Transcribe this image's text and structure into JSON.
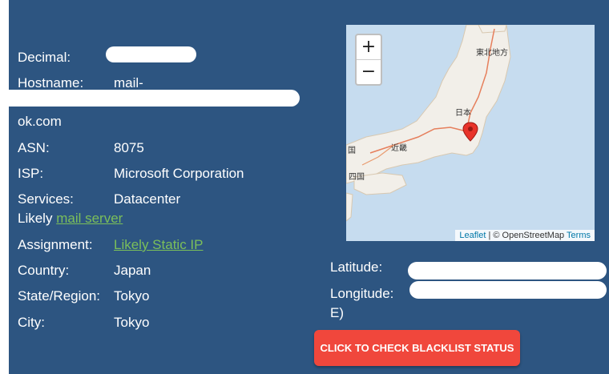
{
  "labels": {
    "decimal": "Decimal:",
    "hostname": "Hostname:",
    "asn": "ASN:",
    "isp": "ISP:",
    "services": "Services:",
    "assignment": "Assignment:",
    "country": "Country:",
    "state": "State/Region:",
    "city": "City:",
    "latitude": "Latitude:",
    "longitude": "Longitude:"
  },
  "values": {
    "hostname_prefix": "mail-",
    "hostname_suffix": "ok.com",
    "asn": "8075",
    "isp": "Microsoft Corporation",
    "services": "Datacenter",
    "services_likely": "Likely",
    "services_link": "mail server",
    "assignment_link": "Likely Static IP",
    "country": "Japan",
    "state": "Tokyo",
    "city": "Tokyo",
    "longitude_suffix": "E)"
  },
  "map": {
    "zoom_in": "+",
    "zoom_out": "−",
    "attr_leaflet": "Leaflet",
    "attr_sep": " | © OpenStreetMap ",
    "attr_terms": "Terms",
    "place_nihon": "日本",
    "place_tohoku": "東北地方",
    "place_kinki": "近畿",
    "place_shikoku": "四国",
    "place_chugoku": "国"
  },
  "button": {
    "label": "CLICK TO CHECK BLACKLIST STATUS"
  },
  "colors": {
    "panel": "#2d5581",
    "link": "#7bbf5a",
    "button": "#f0473c"
  }
}
